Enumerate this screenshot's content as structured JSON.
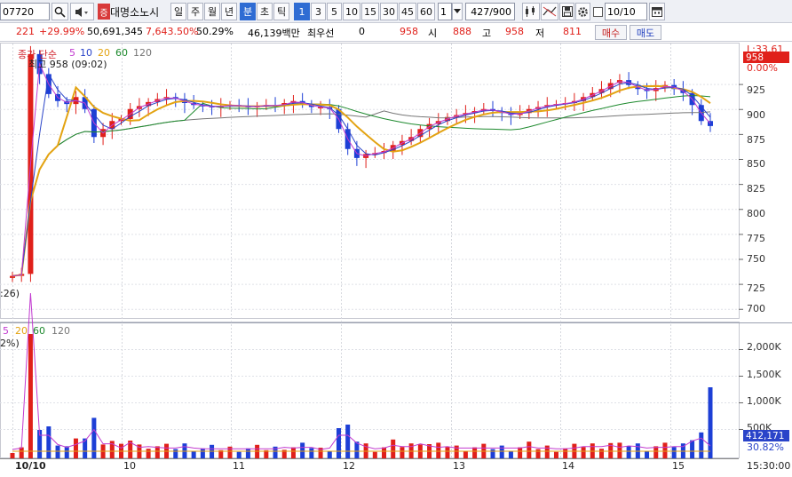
{
  "toolbar": {
    "code": "07720",
    "search_icon": "search-icon",
    "speaker_icon": "speaker-icon",
    "badge": "증",
    "stock_name": "대명소노시",
    "period_tabs": [
      "일",
      "주",
      "월",
      "년",
      "분",
      "초",
      "틱"
    ],
    "active_period": "분",
    "interval_tabs": [
      "1",
      "3",
      "5",
      "10",
      "15",
      "30",
      "45",
      "60"
    ],
    "active_interval": "1",
    "interval_value": "1",
    "count": "427/900",
    "date": "10/10"
  },
  "quote": {
    "change": "221",
    "change_pct": "+29.99%",
    "volume": "50,691,345",
    "volume_pct": "7,643.50%",
    "turnover": "50.29%",
    "amount": "46,139백만",
    "best_label": "최우선",
    "best_value": "0",
    "last_price": "958",
    "open_label": "시",
    "open_value": "888",
    "high_label": "고",
    "high_value": "958",
    "low_label": "저",
    "low_value": "811",
    "buy_label": "매수",
    "sell_label": "매도"
  },
  "price_legend": {
    "prefix": "종가 단순",
    "periods": [
      "5",
      "10",
      "20",
      "60",
      "120"
    ],
    "high_marker": "최고 958 (09:02)",
    "low_marker": ":26)"
  },
  "volume_legend": {
    "periods": [
      "5",
      "20",
      "60",
      "120"
    ],
    "left_label": "2%)"
  },
  "colors": {
    "up": "#e0201a",
    "down": "#1d3fd6",
    "ma5": "#c23bd0",
    "ma10": "#2a44c9",
    "ma20": "#e3a312",
    "ma60": "#1e8a2e",
    "ma120": "#777777"
  },
  "chart_data": {
    "type": "line",
    "price_axis": {
      "ticks": [
        700,
        725,
        750,
        775,
        800,
        825,
        850,
        875,
        900,
        925
      ],
      "ylim": [
        690,
        962
      ],
      "top_labels": [
        "L:33.61",
        "0.00%"
      ],
      "current_price": "958"
    },
    "volume_axis": {
      "ticks": [
        "2,000K",
        "1,500K",
        "1,000K",
        "500K"
      ],
      "current_volume": "412,171",
      "current_pct": "30.82%"
    },
    "x_labels": [
      "10/10",
      "10",
      "11",
      "12",
      "13",
      "14",
      "15"
    ],
    "time_label": "15:30:00",
    "series": [
      {
        "name": "종가",
        "x": [
          0,
          2,
          4,
          6,
          8,
          10,
          12,
          14,
          16,
          18,
          20,
          22,
          24,
          26,
          28,
          30,
          32,
          34,
          36,
          38,
          40,
          42,
          44,
          46,
          48,
          50,
          52,
          54,
          56,
          58,
          60,
          62,
          64,
          66,
          68,
          70,
          72,
          74,
          76,
          78,
          80,
          82,
          84,
          86,
          88,
          90,
          92,
          94,
          96,
          98,
          100,
          102,
          104,
          106,
          108,
          110,
          112,
          114,
          116,
          118,
          120,
          122,
          124,
          126,
          128,
          130,
          132,
          134,
          136,
          138,
          140,
          142,
          144,
          146,
          148,
          150,
          152,
          154
        ],
        "values": [
          733,
          735,
          955,
          935,
          915,
          908,
          905,
          912,
          900,
          872,
          880,
          888,
          890,
          900,
          903,
          907,
          910,
          912,
          910,
          906,
          904,
          903,
          902,
          903,
          904,
          903,
          902,
          903,
          904,
          903,
          906,
          908,
          905,
          902,
          902,
          900,
          880,
          860,
          851,
          855,
          856,
          858,
          864,
          868,
          872,
          880,
          885,
          888,
          892,
          894,
          896,
          898,
          900,
          898,
          896,
          894,
          896,
          900,
          902,
          904,
          905,
          906,
          908,
          912,
          916,
          920,
          926,
          929,
          924,
          920,
          918,
          921,
          924,
          920,
          916,
          904,
          888,
          883
        ]
      }
    ]
  }
}
